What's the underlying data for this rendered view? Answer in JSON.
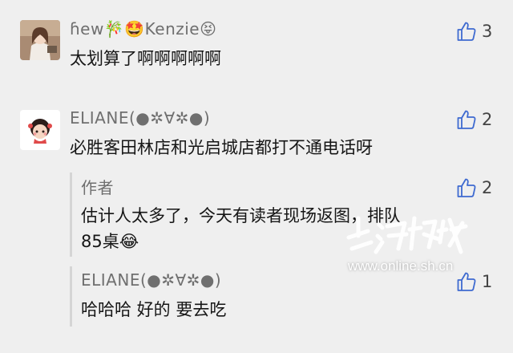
{
  "comments": [
    {
      "username": "ɦew🎋🤩Kenzie😝",
      "content": "太划算了啊啊啊啊啊",
      "likes": "3"
    },
    {
      "username": "ELIANE(●✲∀✲●)",
      "content": "必胜客田林店和光启城店都打不通电话呀",
      "likes": "2",
      "replies": [
        {
          "username": "作者",
          "content_line1": "估计人太多了，今天有读者现场返图，排队",
          "content_line2": "85桌😂",
          "likes": "2"
        },
        {
          "username": "ELIANE(●✲∀✲●)",
          "content": "哈哈哈 好的 要去吃",
          "likes": "1"
        }
      ]
    }
  ],
  "watermark": {
    "url": "www.online.sh.cn"
  },
  "icons": {
    "like": "thumbs-up-icon"
  },
  "colors": {
    "background": "#efefef",
    "username": "#6f6f6f",
    "like_icon": "#3e6ad0"
  }
}
